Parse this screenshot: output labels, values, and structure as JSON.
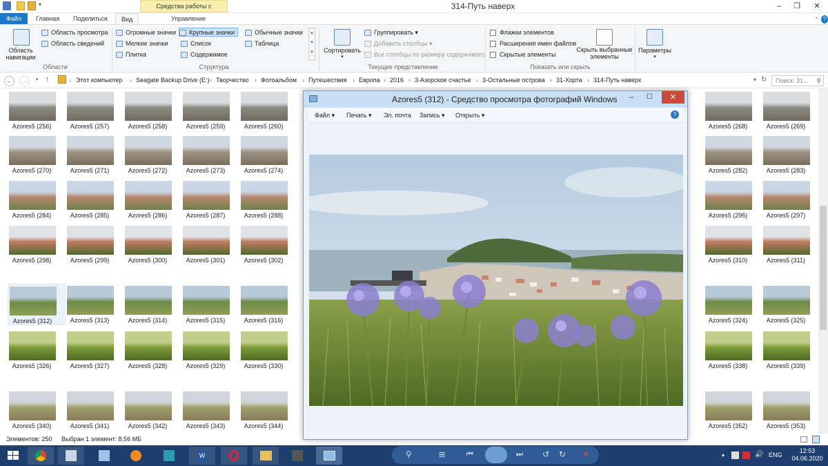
{
  "window": {
    "title": "314-Путь наверх",
    "context_tab": "Средства работы с рисунками"
  },
  "ribbon_tabs": {
    "file": "Файл",
    "home": "Главная",
    "share": "Поделиться",
    "view": "Вид",
    "manage": "Управление"
  },
  "ribbon": {
    "nav_pane": "Область навигации",
    "preview_pane": "Область просмотра",
    "details_pane": "Область сведений",
    "group_areas": "Области",
    "layout": [
      "Огромные значки",
      "Крупные значки",
      "Обычные значки",
      "Мелкие значки",
      "Список",
      "Таблица",
      "Плитка",
      "Содержимое"
    ],
    "group_layout": "Структура",
    "sort": "Сортировать",
    "group_by": "Группировать",
    "add_columns": "Добавить столбцы",
    "fit_columns": "Все столбцы по размеру содержимого",
    "group_current_view": "Текущее представление",
    "item_checkboxes": "Флажки элементов",
    "file_extensions": "Расширения имен файлов",
    "hidden_items": "Скрытые элементы",
    "hide_selected": "Скрыть выбранные элементы",
    "group_show_hide": "Показать или скрыть",
    "options": "Параметры"
  },
  "address": {
    "crumbs": [
      "Этот компьютер",
      "Seagate Backup Drive (E:)",
      "Творчество",
      "Фотоальбом",
      "Путешествия",
      "Европа",
      "2016",
      "3-Азорское счастье",
      "3-Остальные острова",
      "31-Хорта",
      "314-Путь наверх"
    ],
    "search_placeholder": "Поиск: 31..."
  },
  "files_left": [
    [
      "Azores5 (256)",
      "Azores5 (257)",
      "Azores5 (258)",
      "Azores5 (259)",
      "Azores5 (260)"
    ],
    [
      "Azores5 (270)",
      "Azores5 (271)",
      "Azores5 (272)",
      "Azores5 (273)",
      "Azores5 (274)"
    ],
    [
      "Azores5 (284)",
      "Azores5 (285)",
      "Azores5 (286)",
      "Azores5 (287)",
      "Azores5 (288)"
    ],
    [
      "Azores5 (298)",
      "Azores5 (299)",
      "Azores5 (300)",
      "Azores5 (301)",
      "Azores5 (302)"
    ],
    [
      "Azores5 (312)",
      "Azores5 (313)",
      "Azores5 (314)",
      "Azores5 (315)",
      "Azores5 (316)"
    ],
    [
      "Azores5 (326)",
      "Azores5 (327)",
      "Azores5 (328)",
      "Azores5 (329)",
      "Azores5 (330)"
    ],
    [
      "Azores5 (340)",
      "Azores5 (341)",
      "Azores5 (342)",
      "Azores5 (343)",
      "Azores5 (344)"
    ]
  ],
  "files_right": [
    [
      "Azores5 (268)",
      "Azores5 (269)"
    ],
    [
      "Azores5 (282)",
      "Azores5 (283)"
    ],
    [
      "Azores5 (296)",
      "Azores5 (297)"
    ],
    [
      "Azores5 (310)",
      "Azores5 (311)"
    ],
    [
      "Azores5 (324)",
      "Azores5 (325)"
    ],
    [
      "Azores5 (338)",
      "Azores5 (339)"
    ],
    [
      "Azores5 (352)",
      "Azores5 (353)"
    ]
  ],
  "selected_file": "Azores5 (312)",
  "status": {
    "count": "Элементов: 250",
    "selection": "Выбран 1 элемент: 8,56 МБ"
  },
  "viewer": {
    "title": "Azores5 (312) - Средство просмотра фотографий Windows",
    "menu": [
      "Файл",
      "Печать",
      "Эл. почта",
      "Запись",
      "Открыть"
    ]
  },
  "taskbar": {
    "lang": "ENG",
    "time": "12:53",
    "date": "04.06.2020"
  }
}
